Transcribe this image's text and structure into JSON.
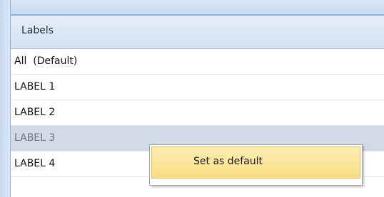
{
  "panel": {
    "header": "Labels",
    "items": [
      {
        "label": "All  (Default)"
      },
      {
        "label": "LABEL 1"
      },
      {
        "label": "LABEL 2"
      },
      {
        "label": "LABEL 3"
      },
      {
        "label": "LABEL 4"
      }
    ],
    "selected_index": 3
  },
  "context_menu": {
    "items": [
      {
        "label": "Set as default"
      }
    ]
  },
  "colors": {
    "header_bg": "#d3e1f2",
    "selected_row": "#d1dbe7",
    "menu_highlight": "#f9dd85"
  }
}
